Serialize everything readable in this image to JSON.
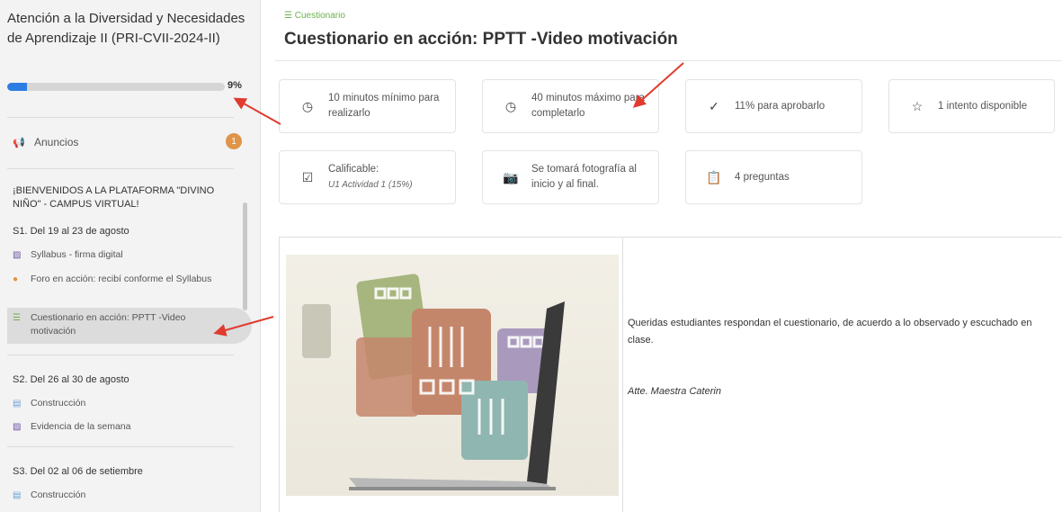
{
  "sidebar": {
    "course_title": "Atención a la Diversidad y Necesidades de Aprendizaje II (PRI-CVII-2024-II)",
    "progress": {
      "percent_label": "9%",
      "value": 0.09
    },
    "announcements": {
      "label": "Anuncios",
      "badge": "1",
      "icon": "megaphone-icon"
    },
    "welcome": "¡BIENVENIDOS A LA PLATAFORMA \"DIVINO NIÑO\" - CAMPUS VIRTUAL!",
    "weeks": [
      {
        "title": "S1. Del 19 al 23 de agosto",
        "items": [
          {
            "label": "Syllabus - firma digital",
            "icon": "assignment-icon"
          },
          {
            "label": "Foro en acción: recibí conforme el Syllabus",
            "icon": "forum-icon"
          },
          {
            "label": "Cuestionario en acción: PPTT -Video motivación",
            "icon": "quiz-icon"
          }
        ]
      },
      {
        "title": "S2. Del 26 al 30 de agosto",
        "items": [
          {
            "label": "Construcción",
            "icon": "document-icon"
          },
          {
            "label": "Evidencia de la semana",
            "icon": "assignment-icon"
          }
        ]
      },
      {
        "title": "S3. Del 02 al 06 de setiembre",
        "items": [
          {
            "label": "Construcción",
            "icon": "document-icon"
          }
        ]
      }
    ]
  },
  "main": {
    "breadcrumb": "Cuestionario",
    "title": "Cuestionario en acción: PPTT -Video motivación",
    "cards": [
      {
        "icon": "clock-icon",
        "text": "10 minutos mínimo para realizarlo"
      },
      {
        "icon": "clock-icon",
        "text": "40 minutos máximo para completarlo"
      },
      {
        "icon": "check-circle-icon",
        "text": "11% para aprobarlo"
      },
      {
        "icon": "star-icon",
        "text": "1 intento disponible"
      },
      {
        "icon": "checkbox-icon",
        "text": "Calificable:",
        "sub": "U1 Actividad 1 (15%)"
      },
      {
        "icon": "camera-icon",
        "text": "Se tomará fotografía al inicio y al final."
      },
      {
        "icon": "clipboard-icon",
        "text": "4 preguntas"
      }
    ],
    "description": "Queridas estudiantes respondan  el cuestionario, de acuerdo a lo observado y escuchado en clase.",
    "signature": "Atte. Maestra Caterin"
  },
  "colors": {
    "accent": "#2d7de3",
    "green": "#6ab04c",
    "badge": "#e0944a",
    "annotation": "#e03b2e"
  }
}
